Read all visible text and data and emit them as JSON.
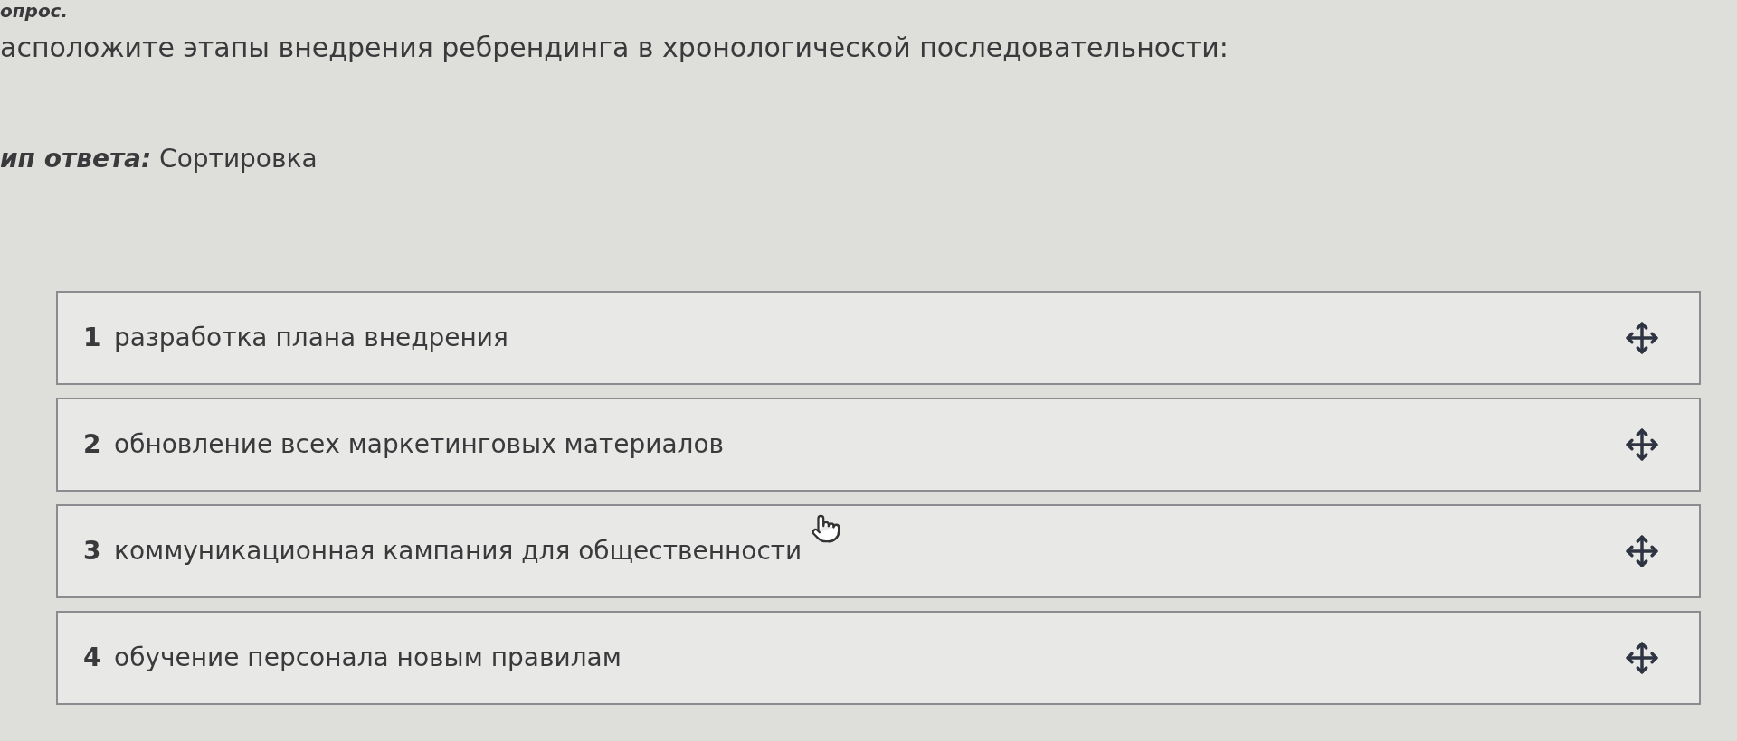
{
  "question_label": "опрос.",
  "question_text": "асположите этапы внедрения ребрендинга в хронологической последовательности:",
  "answer_type": "*ип ответа:* Сортировка",
  "items": [
    {
      "number": "1",
      "text": "разработка плана внедрения"
    },
    {
      "number": "2",
      "text": "обновление всех маркетинговых материалов"
    },
    {
      "number": "3",
      "text": "коммуникационная кампания для общественности"
    },
    {
      "number": "4",
      "text": "обучение персонала новым правилам"
    }
  ]
}
